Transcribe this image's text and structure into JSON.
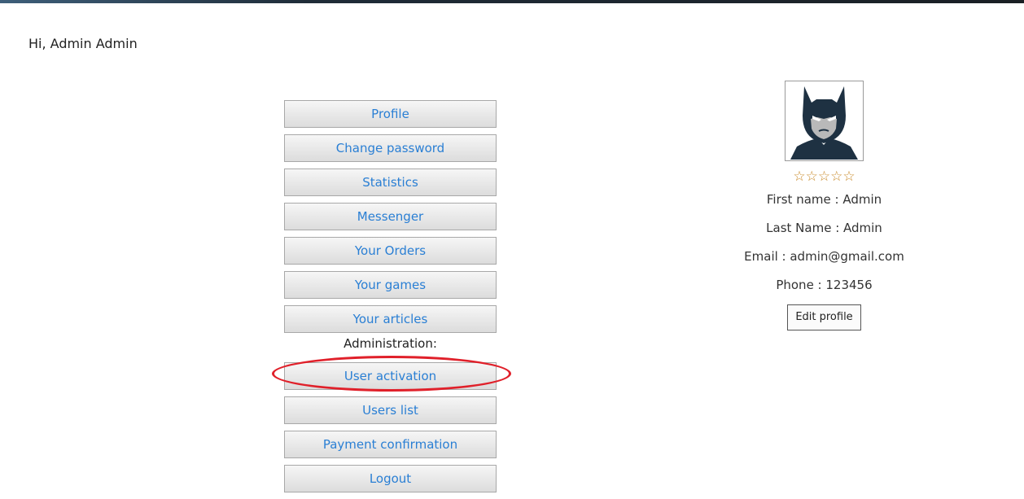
{
  "header": {
    "greeting": "Hi, Admin Admin"
  },
  "menu": {
    "items": [
      {
        "label": "Profile"
      },
      {
        "label": "Change password"
      },
      {
        "label": "Statistics"
      },
      {
        "label": "Messenger"
      },
      {
        "label": "Your Orders"
      },
      {
        "label": "Your games"
      },
      {
        "label": "Your articles"
      }
    ],
    "admin_heading": "Administration:",
    "admin_items": [
      {
        "label": "User activation"
      },
      {
        "label": "Users list"
      },
      {
        "label": "Payment confirmation"
      },
      {
        "label": "Logout"
      }
    ]
  },
  "profile": {
    "avatar_icon": "batman-avatar-icon",
    "rating": 0,
    "rating_max": 5,
    "stars": "☆☆☆☆☆",
    "first_name": "First name : Admin",
    "last_name": "Last Name : Admin",
    "email": "Email : admin@gmail.com",
    "phone": "Phone : 123456",
    "edit_label": "Edit profile"
  },
  "colors": {
    "link": "#2a7fd4",
    "highlight": "#e0202a",
    "star": "#c98a2a"
  }
}
